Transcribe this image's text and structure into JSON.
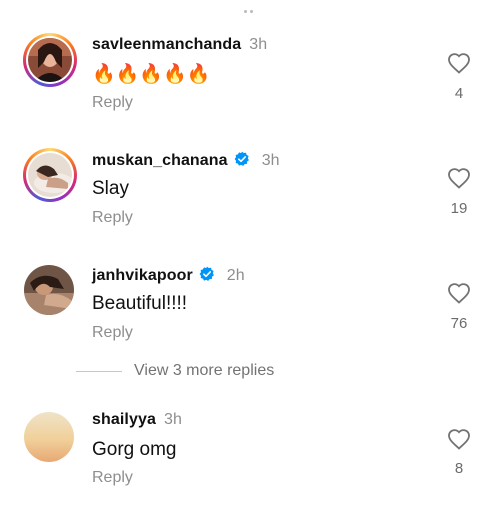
{
  "comments": [
    {
      "username": "savleenmanchanda",
      "time": "3h",
      "verified": false,
      "text": "🔥🔥🔥🔥🔥",
      "reply_label": "Reply",
      "likes": "4"
    },
    {
      "username": "muskan_chanana",
      "time": "3h",
      "verified": true,
      "text": "Slay",
      "reply_label": "Reply",
      "likes": "19"
    },
    {
      "username": "janhvikapoor",
      "time": "2h",
      "verified": true,
      "text": "Beautiful!!!!",
      "reply_label": "Reply",
      "likes": "76"
    },
    {
      "username": "shailyya",
      "time": "3h",
      "verified": false,
      "text": "Gorg omg",
      "reply_label": "Reply",
      "likes": "8"
    }
  ],
  "view_more_replies": "View 3 more replies",
  "colors": {
    "verified_blue": "#0095f6",
    "muted_text": "#8e8e8e"
  }
}
